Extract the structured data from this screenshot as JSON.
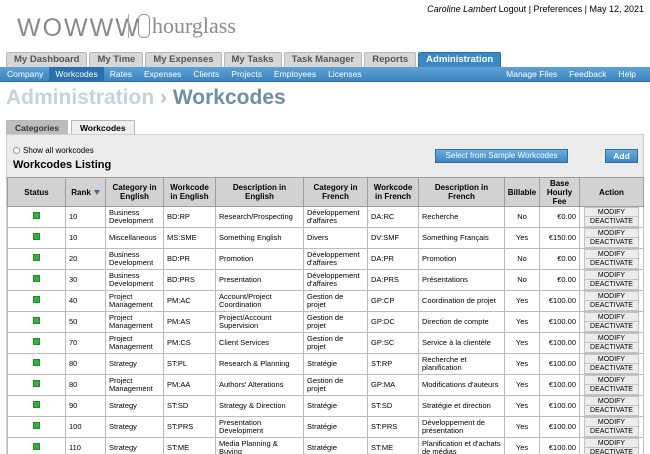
{
  "brand": {
    "logo": "WOWWW",
    "product": "hourglass"
  },
  "user": {
    "name": "Caroline Lambert",
    "logout": "Logout",
    "sep1": "|",
    "preferences": "Preferences",
    "sep2": "|",
    "date": "May 12, 2021"
  },
  "tabs": [
    {
      "label": "My Dashboard",
      "active": false
    },
    {
      "label": "My Time",
      "active": false
    },
    {
      "label": "My Expenses",
      "active": false
    },
    {
      "label": "My Tasks",
      "active": false
    },
    {
      "label": "Task Manager",
      "active": false
    },
    {
      "label": "Reports",
      "active": false
    },
    {
      "label": "Administration",
      "active": true
    }
  ],
  "subnav": {
    "left": [
      "Company",
      "Workcodes",
      "Rates",
      "Expenses",
      "Clients",
      "Projects",
      "Employees",
      "Licenses"
    ],
    "active": "Workcodes",
    "right": [
      "Manage Files",
      "Feedback",
      "Help"
    ]
  },
  "page": {
    "crumb": "Administration",
    "sep": "›",
    "current": "Workcodes"
  },
  "subtabs": [
    {
      "label": "Categories",
      "active": false
    },
    {
      "label": "Workcodes",
      "active": true
    }
  ],
  "listing": {
    "show_all": "Show all workcodes",
    "title": "Workcodes Listing",
    "sample_button": "Select from Sample Workcodes",
    "add_button": "Add",
    "columns": [
      "Status",
      "Rank",
      "Category in English",
      "Workcode in English",
      "Description in English",
      "Category in French",
      "Workcode in French",
      "Description in French",
      "Billable",
      "Base Hourly Fee",
      "Action"
    ],
    "modify": "MODIFY",
    "deactivate": "DEACTIVATE",
    "status_color": "#2eb33b",
    "rows": [
      [
        "10",
        "Business Development",
        "BD:RP",
        "Research/Prospecting",
        "Développement d'affaires",
        "DA:RC",
        "Recherche",
        "No",
        "€0.00"
      ],
      [
        "10",
        "Miscellaneous",
        "MS:SME",
        "Something English",
        "Divers",
        "DV:SMF",
        "Something Français",
        "Yes",
        "€150.00"
      ],
      [
        "20",
        "Business Development",
        "BD:PR",
        "Promotion",
        "Développement d'affaires",
        "DA:PR",
        "Promotion",
        "No",
        "€0.00"
      ],
      [
        "30",
        "Business Development",
        "BD:PRS",
        "Presentation",
        "Développement d'affaires",
        "DA:PRS",
        "Présentations",
        "No",
        "€0.00"
      ],
      [
        "40",
        "Project Management",
        "PM:AC",
        "Account/Project Coordination",
        "Gestion de projet",
        "GP:CP",
        "Coordination de projet",
        "Yes",
        "€100.00"
      ],
      [
        "50",
        "Project Management",
        "PM:AS",
        "Project/Account Supervision",
        "Gestion de projet",
        "GP:DC",
        "Direction de compte",
        "Yes",
        "€100.00"
      ],
      [
        "70",
        "Project Management",
        "PM:CS",
        "Client Services",
        "Gestion de projet",
        "GP:SC",
        "Service à la clientèle",
        "Yes",
        "€100.00"
      ],
      [
        "80",
        "Strategy",
        "ST:PL",
        "Research & Planning",
        "Stratégie",
        "ST:RP",
        "Recherche et planification",
        "Yes",
        "€100.00"
      ],
      [
        "80",
        "Project Management",
        "PM:AA",
        "Authors' Alterations",
        "Gestion de projet",
        "GP:MA",
        "Modifications d'auteurs",
        "Yes",
        "€100.00"
      ],
      [
        "90",
        "Strategy",
        "ST:SD",
        "Strategy & Direction",
        "Stratégie",
        "ST:SD",
        "Stratégie et direction",
        "Yes",
        "€100.00"
      ],
      [
        "100",
        "Strategy",
        "ST:PRS",
        "Presentation Development",
        "Stratégie",
        "ST:PRS",
        "Développement de présentation",
        "Yes",
        "€100.00"
      ],
      [
        "110",
        "Strategy",
        "ST:ME",
        "Media Planning & Buying",
        "Stratégie",
        "ST:ME",
        "Planification et d'achats de médias",
        "Yes",
        "€100.00"
      ]
    ]
  }
}
